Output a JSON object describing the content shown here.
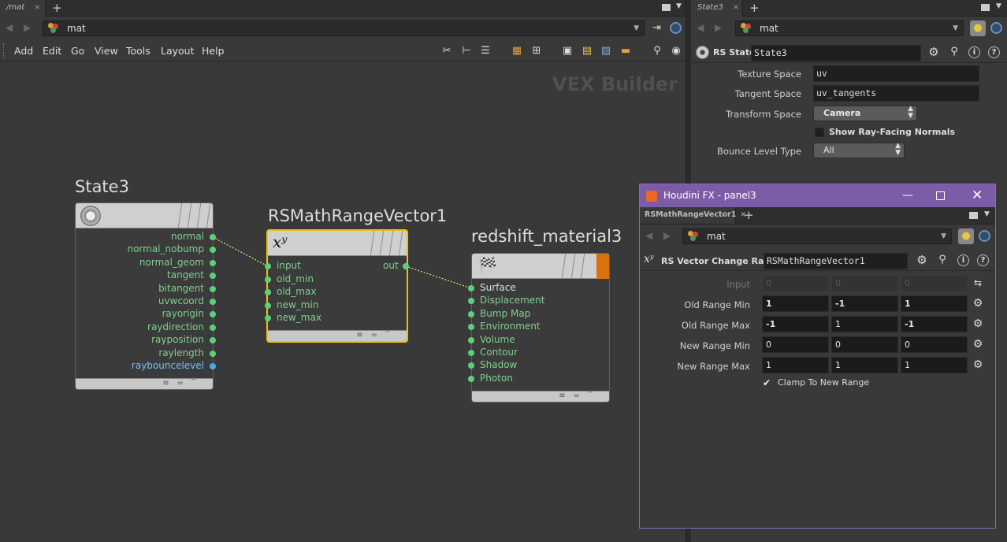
{
  "left_pane": {
    "tab_label": "/mat",
    "tab_close": "×",
    "tab_add": "+",
    "path": "mat",
    "menus": [
      "Add",
      "Edit",
      "Go",
      "View",
      "Tools",
      "Layout",
      "Help"
    ],
    "watermark": "VEX Builder"
  },
  "nodes": {
    "state3": {
      "name": "State3",
      "outputs": [
        "normal",
        "normal_nobump",
        "normal_geom",
        "tangent",
        "bitangent",
        "uvwcoord",
        "rayorigin",
        "raydirection",
        "rayposition",
        "raylength",
        "raybouncelevel"
      ]
    },
    "range": {
      "name": "RSMathRangeVector1",
      "icon_text": "xʸ",
      "inputs": [
        "input",
        "old_min",
        "old_max",
        "new_min",
        "new_max"
      ],
      "output": "out"
    },
    "material": {
      "name": "redshift_material3",
      "inputs": [
        "Surface",
        "Displacement",
        "Bump Map",
        "Environment",
        "Volume",
        "Contour",
        "Shadow",
        "Photon"
      ]
    }
  },
  "right_pane": {
    "tab_label": "State3",
    "tab_close": "×",
    "tab_add": "+",
    "path": "mat",
    "node_type": "RS State",
    "node_name": "State3",
    "parms": {
      "texture_space_label": "Texture Space",
      "texture_space_value": "uv",
      "tangent_space_label": "Tangent Space",
      "tangent_space_value": "uv_tangents",
      "transform_space_label": "Transform Space",
      "transform_space_value": "Camera",
      "ray_facing_label": "Show Ray-Facing Normals",
      "bounce_label": "Bounce Level Type",
      "bounce_value": "All"
    }
  },
  "float_panel": {
    "title": "Houdini FX - panel3",
    "tab_label": "RSMathRangeVector1",
    "tab_close": "×",
    "tab_add": "+",
    "path": "mat",
    "node_type": "RS Vector Change Range",
    "node_name": "RSMathRangeVector1",
    "rows": [
      {
        "label": "Input",
        "values": [
          "0",
          "0",
          "0"
        ]
      },
      {
        "label": "Old Range Min",
        "values": [
          "1",
          "-1",
          "1"
        ]
      },
      {
        "label": "Old Range Max",
        "values": [
          "-1",
          "1",
          "-1"
        ]
      },
      {
        "label": "New Range Min",
        "values": [
          "0",
          "0",
          "0"
        ]
      },
      {
        "label": "New Range Max",
        "values": [
          "1",
          "1",
          "1"
        ]
      }
    ],
    "clamp_label": "Clamp To New Range",
    "clamp_checked": true
  },
  "colors": {
    "accent_purple": "#7b5ca6",
    "selected_node": "#f0c000",
    "port_green": "#5fcf7b",
    "port_blue": "#4aa8e0"
  }
}
